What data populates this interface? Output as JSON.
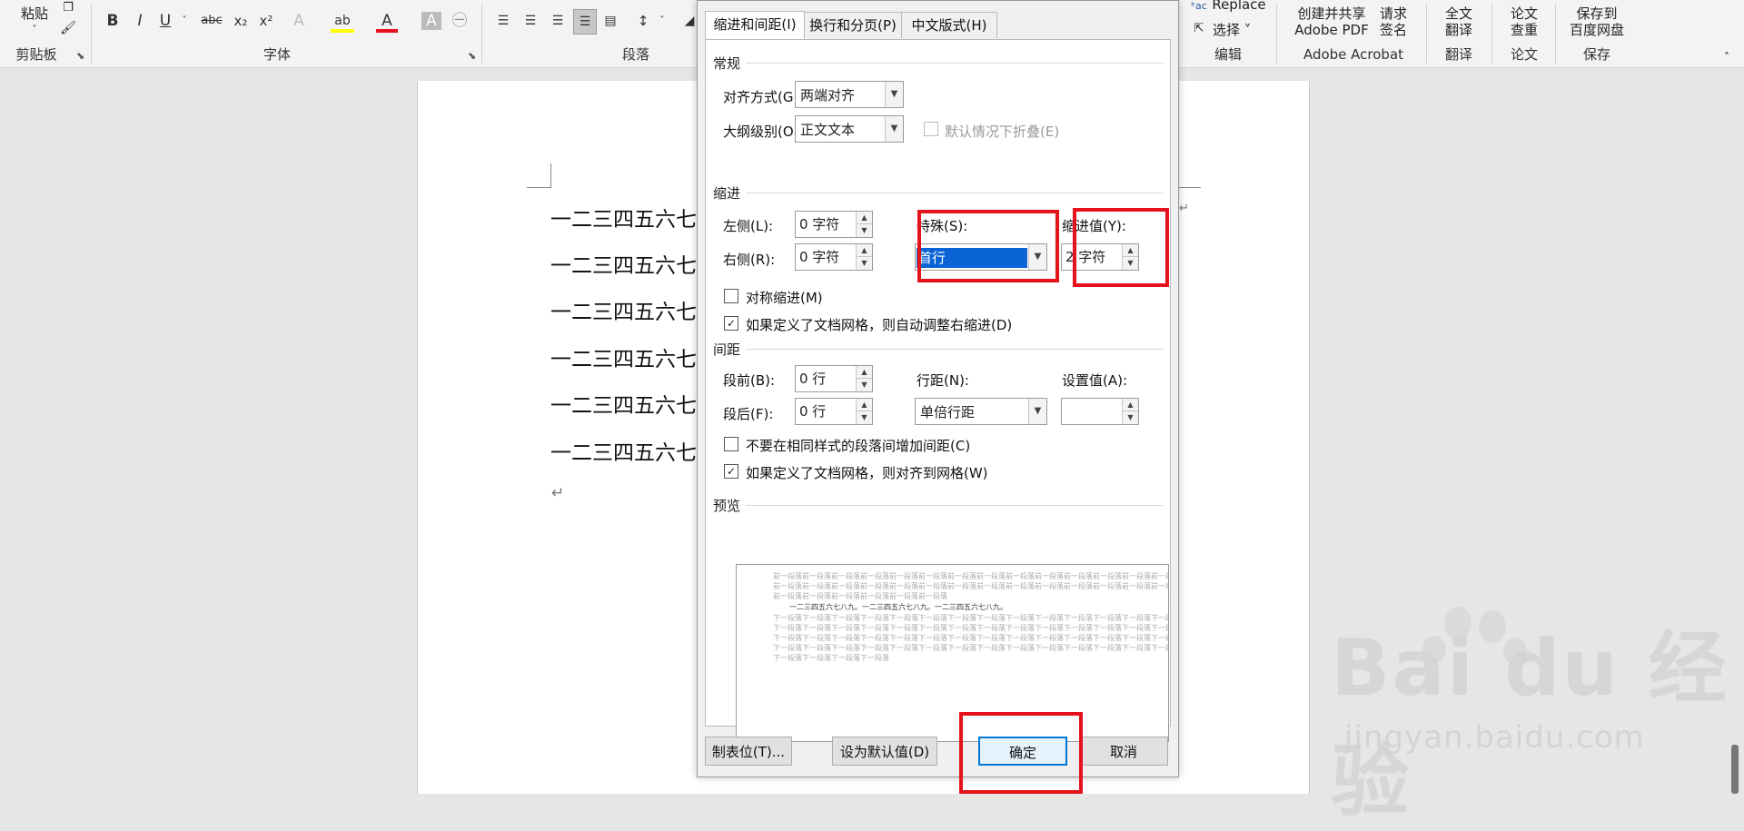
{
  "ribbon": {
    "paste_label": "粘贴",
    "clipboard_label": "剪贴板",
    "font_label": "字体",
    "paragraph_label": "段落",
    "font_buttons": [
      "B",
      "I",
      "U",
      "abc",
      "x₂",
      "x²",
      "A",
      "ab",
      "A",
      "A",
      "㊀"
    ],
    "replace_label": "Replace",
    "select_label": "选择 ˅",
    "edit_label": "编辑",
    "create_share_pdf": [
      "创建并共享",
      "Adobe PDF"
    ],
    "request_sign": [
      "请求",
      "签名"
    ],
    "adobe_label": "Adobe Acrobat",
    "full_translate": [
      "全文",
      "翻译"
    ],
    "translate_label": "翻译",
    "paper_check": [
      "论文",
      "查重"
    ],
    "paper_label": "论文",
    "save_baidu": [
      "保存到",
      "百度网盘"
    ],
    "save_label": "保存"
  },
  "document": {
    "lines": [
      "一二三四五六七",
      "一二三四五六七",
      "一二三四五六七",
      "一二三四五六七",
      "一二三四五六七",
      "一二三四五六七"
    ],
    "pilcrow": "↵"
  },
  "dialog": {
    "tabs": [
      "缩进和间距(I)",
      "换行和分页(P)",
      "中文版式(H)"
    ],
    "general": {
      "title": "常规",
      "alignment_label": "对齐方式(G):",
      "alignment_value": "两端对齐",
      "outline_label": "大纲级别(O):",
      "outline_value": "正文文本",
      "collapse_label": "默认情况下折叠(E)"
    },
    "indent": {
      "title": "缩进",
      "left_label": "左侧(L):",
      "left_value": "0 字符",
      "right_label": "右侧(R):",
      "right_value": "0 字符",
      "special_label": "特殊(S):",
      "special_value": "首行",
      "by_label": "缩进值(Y):",
      "by_value": "2 字符",
      "mirror_label": "对称缩进(M)",
      "mirror_checked": false,
      "auto_adjust_label": "如果定义了文档网格，则自动调整右缩进(D)",
      "auto_adjust_checked": true
    },
    "spacing": {
      "title": "间距",
      "before_label": "段前(B):",
      "before_value": "0 行",
      "after_label": "段后(F):",
      "after_value": "0 行",
      "line_label": "行距(N):",
      "line_value": "单倍行距",
      "at_label": "设置值(A):",
      "at_value": "",
      "no_space_label": "不要在相同样式的段落间增加间距(C)",
      "no_space_checked": false,
      "snap_grid_label": "如果定义了文档网格，则对齐到网格(W)",
      "snap_grid_checked": true
    },
    "preview": {
      "title": "预览",
      "prev_lines": [
        "前一段落前一段落前一段落前一段落前一段落前一段落前一段落前一段落前一段落前一段落前一段落前一段落前一段落前一段落前一段落",
        "前一段落前一段落前一段落前一段落前一段落前一段落前一段落前一段落前一段落前一段落前一段落前一段落前一段落前一段落前一段落",
        "前一段落前一段落前一段落前一段落前一段落前一段落"
      ],
      "main_line": "一二三四五六七八九。一二三四五六七八九。一二三四五六七八九。",
      "next_lines": [
        "下一段落下一段落下一段落下一段落下一段落下一段落下一段落下一段落下一段落下一段落下一段落下一段落下一段落下一段落下一段落",
        "下一段落下一段落下一段落下一段落下一段落下一段落下一段落下一段落下一段落下一段落下一段落下一段落下一段落下一段落下一段落",
        "下一段落下一段落下一段落下一段落下一段落下一段落下一段落下一段落下一段落下一段落下一段落下一段落下一段落下一段落下一段落",
        "下一段落下一段落下一段落下一段落下一段落下一段落下一段落下一段落下一段落下一段落下一段落下一段落下一段落下一段落下一段落",
        "下一段落下一段落下一段落下一段落"
      ]
    },
    "buttons": {
      "tabs": "制表位(T)...",
      "set_default": "设为默认值(D)",
      "ok": "确定",
      "cancel": "取消"
    }
  },
  "watermark": {
    "brand": "Bai du 经验",
    "url": "jingyan.baidu.com"
  },
  "colors": {
    "highlight_red": "#e4131b",
    "selection_blue": "#0a64d6",
    "default_button_border": "#0078d7"
  }
}
